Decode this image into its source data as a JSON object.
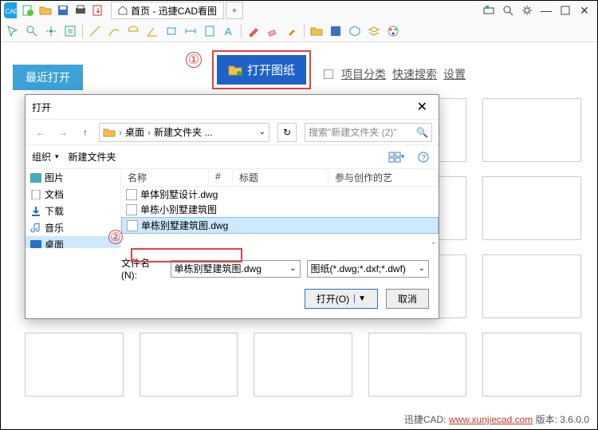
{
  "titlebar": {
    "tab_title": "首页 - 迅捷CAD看图",
    "icons": [
      "logo",
      "new",
      "open",
      "save",
      "print",
      "undo"
    ]
  },
  "app": {
    "recent_tab": "最近打开",
    "open_button": "打开图纸",
    "callout1": "①",
    "links": {
      "category": "项目分类",
      "search": "快速搜索",
      "settings": "设置"
    }
  },
  "dialog": {
    "title": "打开",
    "path_desktop": "桌面",
    "path_folder": "新建文件夹 ...",
    "search_placeholder": "搜索\"新建文件夹 (2)\"",
    "toolbar_organize": "组织",
    "toolbar_newfolder": "新建文件夹",
    "tree": [
      {
        "label": "图片",
        "icon": "pic"
      },
      {
        "label": "文档",
        "icon": "doc"
      },
      {
        "label": "下载",
        "icon": "dl"
      },
      {
        "label": "音乐",
        "icon": "music"
      },
      {
        "label": "桌面",
        "icon": "desk",
        "sel": true
      }
    ],
    "columns": {
      "name": "名称",
      "num": "#",
      "title": "标题",
      "contrib": "参与创作的艺"
    },
    "files": [
      {
        "name": "单体别墅设计.dwg"
      },
      {
        "name": "单栋小别墅建筑图"
      },
      {
        "name": "单栋别墅建筑图.dwg",
        "sel": true
      }
    ],
    "callout2": "②",
    "filename_label": "文件名(N):",
    "filename_value": "单栋别墅建筑图.dwg",
    "filetype_value": "图纸(*.dwg;*.dxf;*.dwf)",
    "open_btn": "打开(O)",
    "cancel_btn": "取消"
  },
  "footer": {
    "brand": "迅捷CAD:",
    "url": "www.xunjiecad.com",
    "version_label": "版本:",
    "version": "3.6.0.0"
  }
}
